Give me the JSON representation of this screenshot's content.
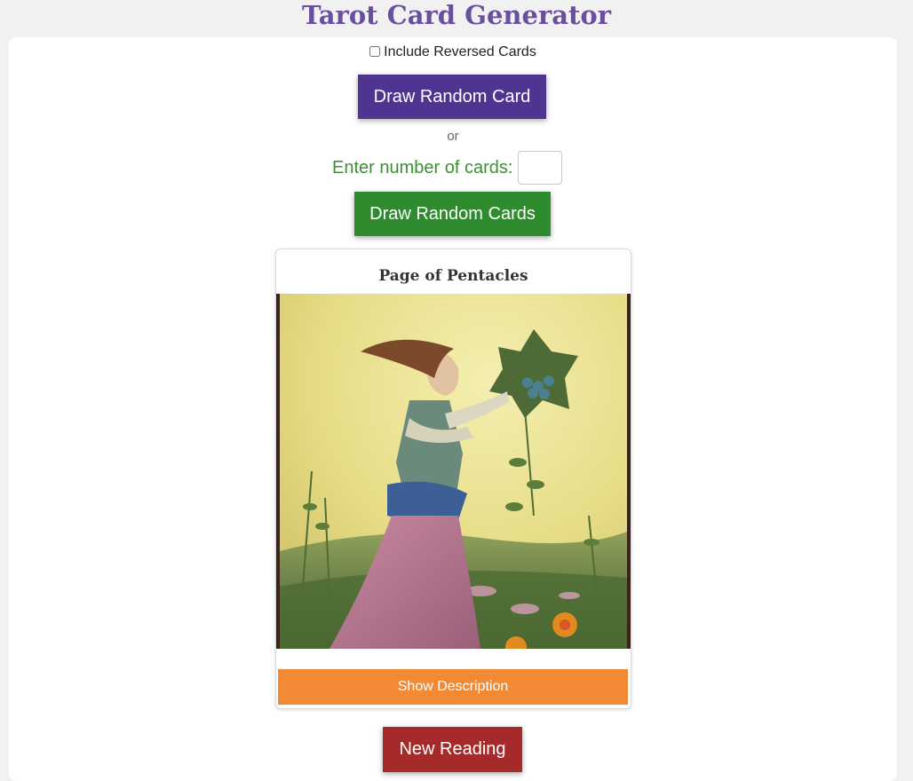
{
  "header": {
    "title": "Tarot Card Generator"
  },
  "controls": {
    "reversed_label": "Include Reversed Cards",
    "reversed_checked": false,
    "draw_one_label": "Draw Random Card",
    "or_text": "or",
    "count_label": "Enter number of cards:",
    "count_value": "",
    "draw_many_label": "Draw Random Cards"
  },
  "card": {
    "name": "Page of Pentacles",
    "show_description_label": "Show Description"
  },
  "footer": {
    "new_reading_label": "New Reading"
  },
  "colors": {
    "title": "#6a4fa0",
    "draw_one_button": "#4f3591",
    "count_label": "#3f8f35",
    "draw_many_button": "#2e8b2e",
    "description_button": "#f28a35",
    "new_reading_button": "#a52a2a"
  }
}
